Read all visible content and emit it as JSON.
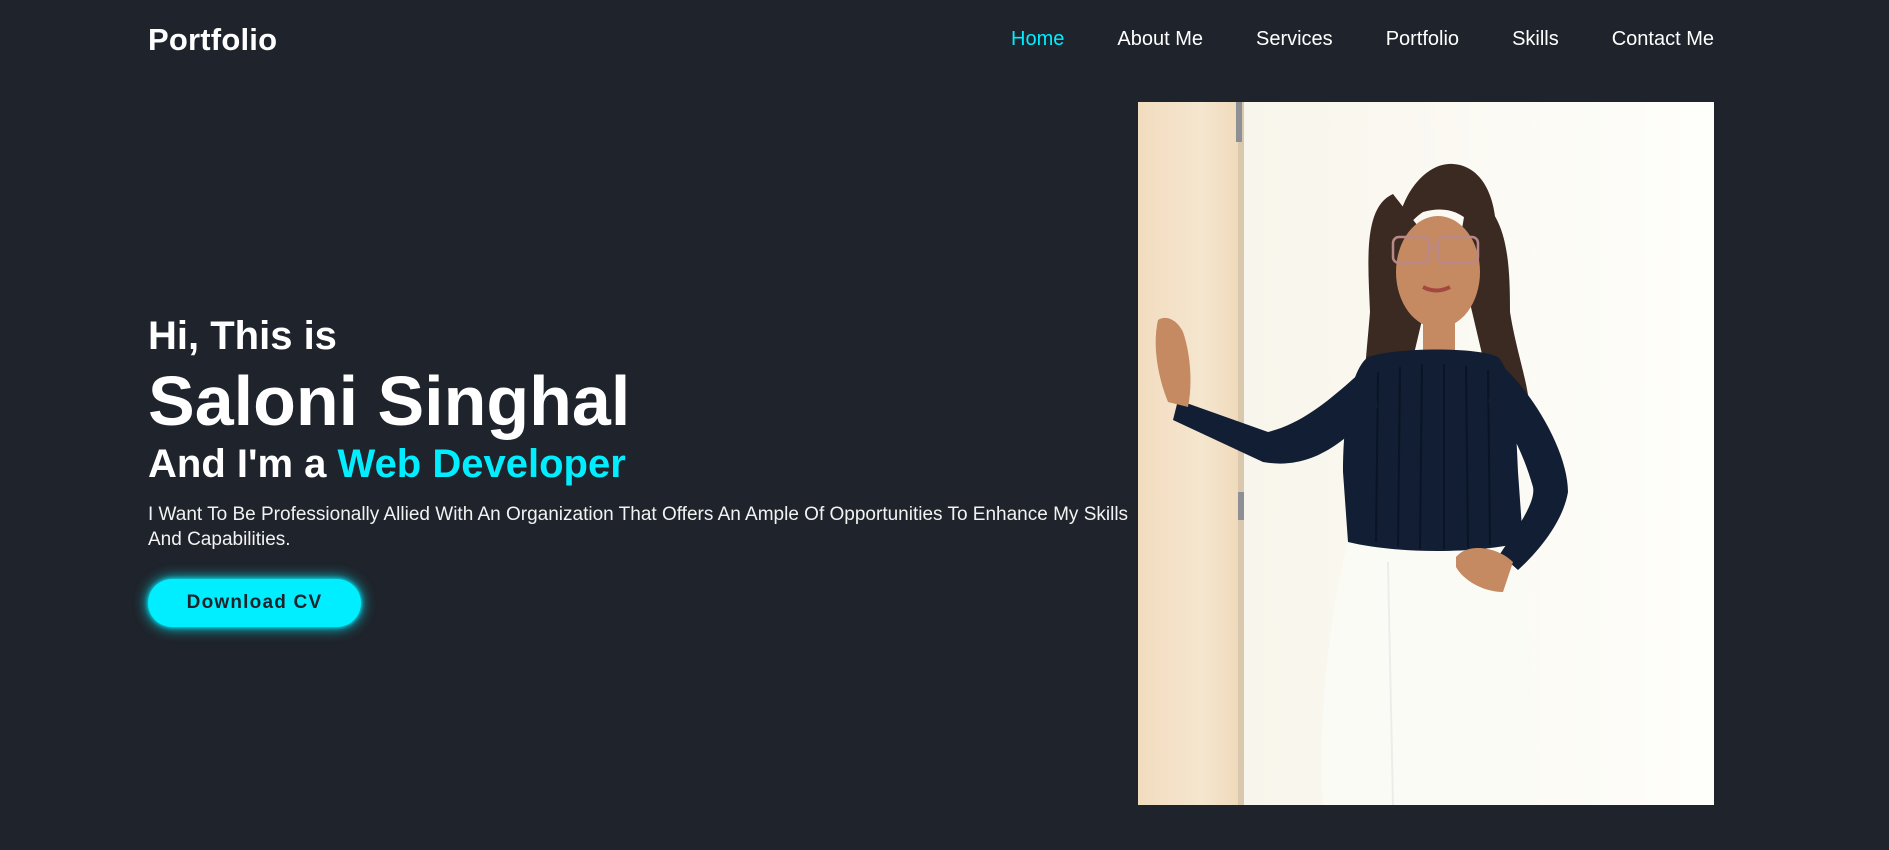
{
  "header": {
    "logo": "Portfolio",
    "nav": [
      {
        "label": "Home",
        "active": true
      },
      {
        "label": "About Me"
      },
      {
        "label": "Services"
      },
      {
        "label": "Portfolio"
      },
      {
        "label": "Skills"
      },
      {
        "label": "Contact Me"
      }
    ]
  },
  "hero": {
    "greeting": "Hi, This is",
    "name": "Saloni Singhal",
    "role_prefix": "And I'm a ",
    "role_highlight": "Web Developer",
    "description": "I Want To Be Professionally Allied With An Organization That Offers An Ample Of Opportunities To Enhance My Skills And Capabilities.",
    "cta_label": "Download CV"
  },
  "colors": {
    "background": "#1f232b",
    "accent": "#00eeff",
    "text": "#ffffff"
  },
  "icons": {
    "profile_photo": "portrait-photo"
  }
}
